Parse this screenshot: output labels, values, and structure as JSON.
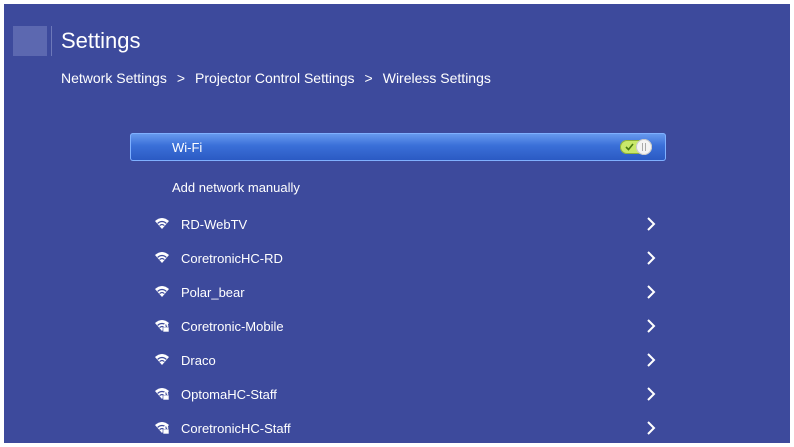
{
  "header": {
    "title": "Settings"
  },
  "breadcrumb": {
    "items": [
      "Network Settings",
      "Projector Control Settings",
      "Wireless Settings"
    ],
    "separator": ">"
  },
  "wifi": {
    "label": "Wi-Fi",
    "enabled": true
  },
  "add_network": {
    "label": "Add network manually"
  },
  "networks": [
    {
      "name": "RD-WebTV",
      "icon": "wifi-icon"
    },
    {
      "name": "CoretronicHC-RD",
      "icon": "wifi-icon"
    },
    {
      "name": "Polar_bear",
      "icon": "wifi-icon"
    },
    {
      "name": "Coretronic-Mobile",
      "icon": "wifi-secured-icon"
    },
    {
      "name": "Draco",
      "icon": "wifi-icon"
    },
    {
      "name": "OptomaHC-Staff",
      "icon": "wifi-secured-icon"
    },
    {
      "name": "CoretronicHC-Staff",
      "icon": "wifi-secured-icon"
    }
  ],
  "colors": {
    "background": "#3d4a9c",
    "highlight": "#3a6fd8",
    "toggle_on": "#c9e86a",
    "text": "#ffffff"
  }
}
